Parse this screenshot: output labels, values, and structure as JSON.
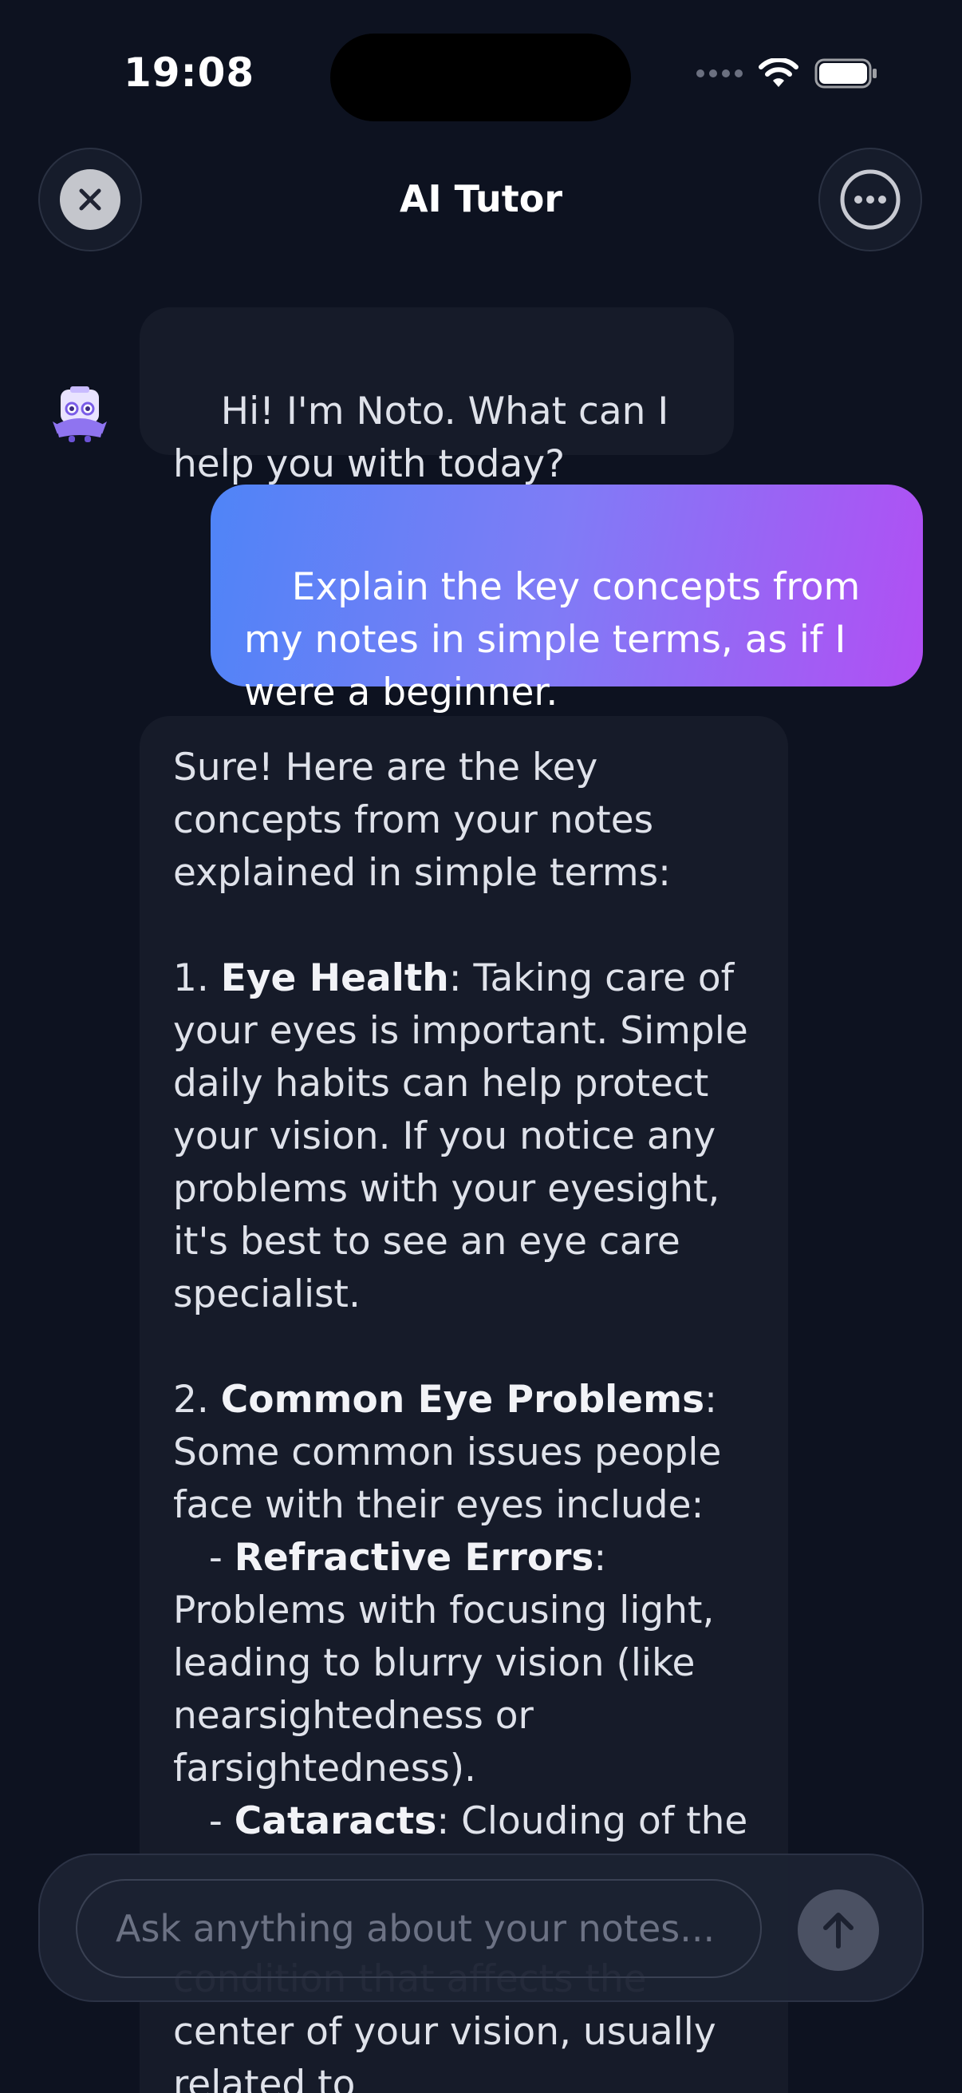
{
  "status_bar": {
    "time": "19:08"
  },
  "header": {
    "title": "AI Tutor",
    "close_icon": "close-icon",
    "more_icon": "more-horizontal-icon"
  },
  "messages": [
    {
      "role": "assistant",
      "text": "Hi! I'm Noto. What can I help you with today?"
    },
    {
      "role": "user",
      "text": "Explain the key concepts from my notes in simple terms, as if I were a beginner."
    },
    {
      "role": "assistant",
      "intro": "Sure! Here are the key concepts from your notes explained in simple terms:",
      "section1_num": "1. ",
      "section1_title": "Eye Health",
      "section1_body": ": Taking care of your eyes is important. Simple daily habits can help protect your vision. If you notice any problems with your eyesight, it's best to see an eye care specialist.",
      "section2_num": "2. ",
      "section2_title": "Common Eye Problems",
      "section2_body": ": Some common issues people face with their eyes include:",
      "sub1_prefix": "   - ",
      "sub1_title": "Refractive Errors",
      "sub1_body": ": Problems with focusing light, leading to blurry vision (like nearsightedness or farsightedness).",
      "sub2_prefix": "   - ",
      "sub2_title": "Cataracts",
      "sub2_body": ": Clouding of the",
      "hidden_continuation": "condition that affects the center of your vision, usually related to"
    }
  ],
  "composer": {
    "placeholder": "Ask anything about your notes...",
    "send_icon": "arrow-up-icon"
  },
  "colors": {
    "background": "#0d1220",
    "assistant_bubble": "#161b29",
    "user_gradient_start": "#4f84f7",
    "user_gradient_end": "#b14ff3",
    "send_button": "#4b5163"
  }
}
